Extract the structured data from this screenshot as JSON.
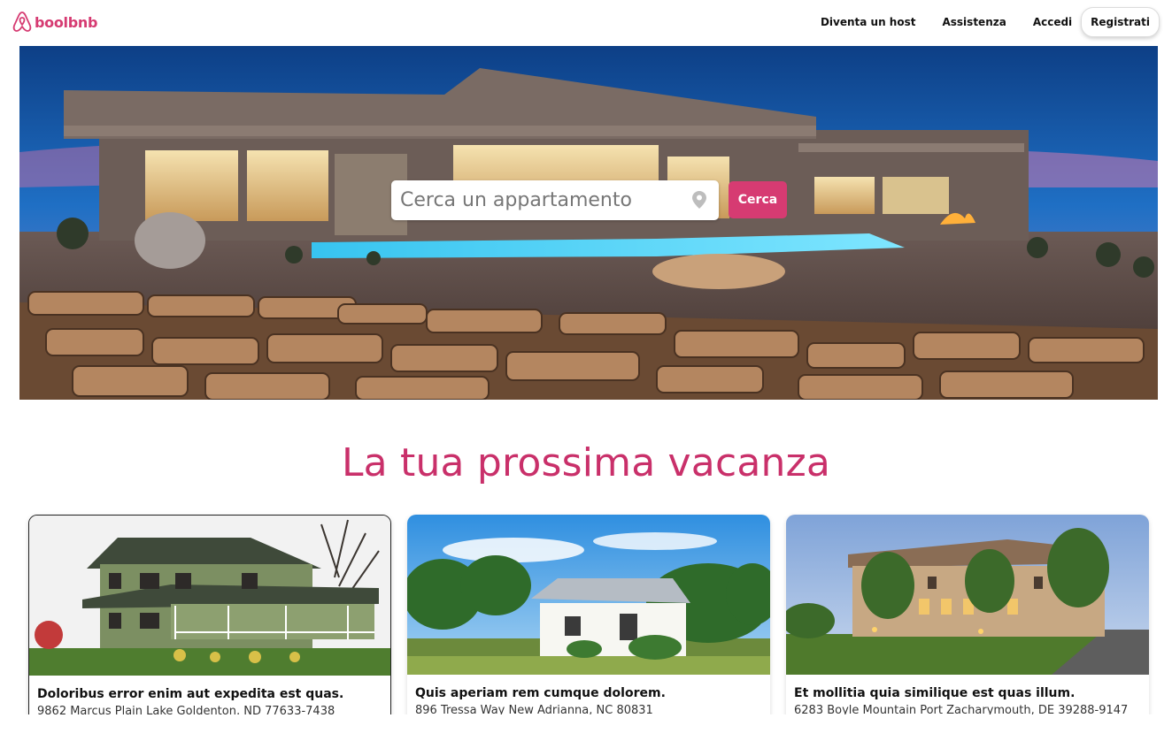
{
  "header": {
    "logo_text": "boolbnb",
    "nav": {
      "host_label": "Diventa un host",
      "help_label": "Assistenza",
      "login_label": "Accedi",
      "register_label": "Registrati"
    }
  },
  "hero": {
    "search": {
      "placeholder": "Cerca un appartamento",
      "button_label": "Cerca",
      "icon": "map-pin-icon"
    }
  },
  "section": {
    "title": "La tua prossima vacanza"
  },
  "cards": [
    {
      "title": "Doloribus error enim aut expedita est quas.",
      "address": "9862 Marcus Plain Lake Goldenton, ND 77633-7438"
    },
    {
      "title": "Quis aperiam rem cumque dolorem.",
      "address": "896 Tressa Way New Adrianna, NC 80831"
    },
    {
      "title": "Et mollitia quia similique est quas illum.",
      "address": "6283 Boyle Mountain Port Zacharymouth, DE 39288-9147"
    }
  ],
  "colors": {
    "accent": "#d63b72",
    "title": "#c9306a"
  }
}
